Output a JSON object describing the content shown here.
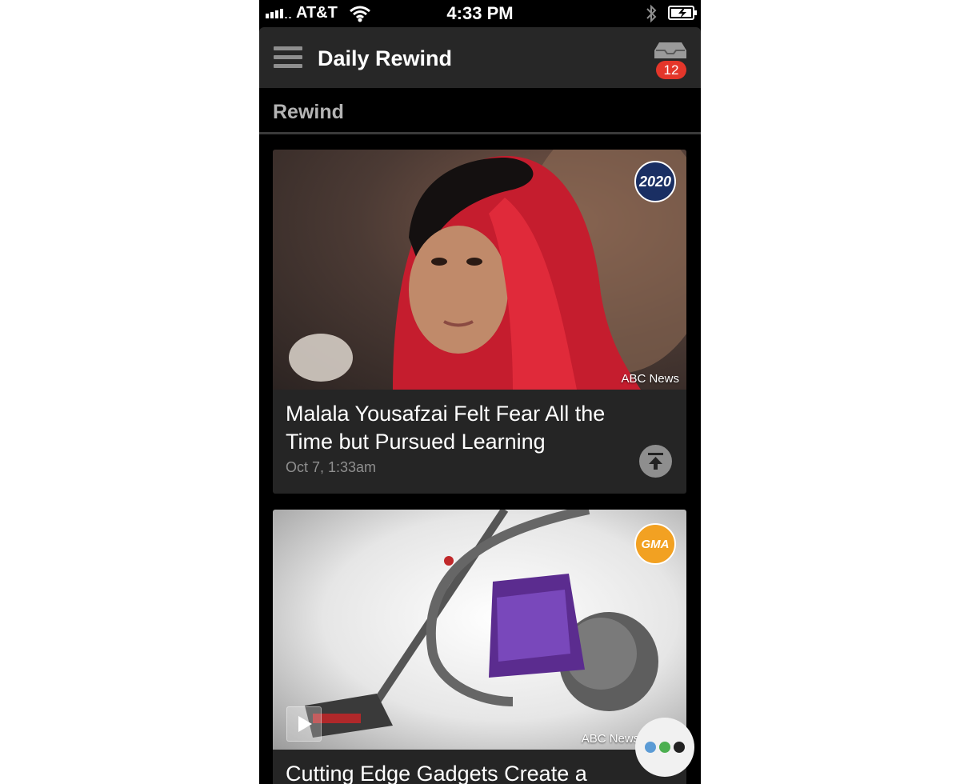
{
  "status_bar": {
    "carrier": "AT&T",
    "time": "4:33 PM"
  },
  "header": {
    "title": "Daily Rewind",
    "inbox_count": "12"
  },
  "section": {
    "title": "Rewind"
  },
  "cards": [
    {
      "headline": "Malala Yousafzai Felt Fear All the Time but Pursued Learning",
      "date": "Oct 7, 1:33am",
      "source_label": "ABC News",
      "logo_text": "2020",
      "logo_color": "#1a2f63"
    },
    {
      "headline": "Cutting Edge Gadgets Create a",
      "source_label": "ABC News Videos",
      "logo_text": "GMA",
      "logo_color": "#f2a122"
    }
  ],
  "colors": {
    "header_bg": "#272727",
    "badge": "#e4362a",
    "fab_dots": [
      "#5b9bd5",
      "#4caf50",
      "#222222"
    ]
  }
}
